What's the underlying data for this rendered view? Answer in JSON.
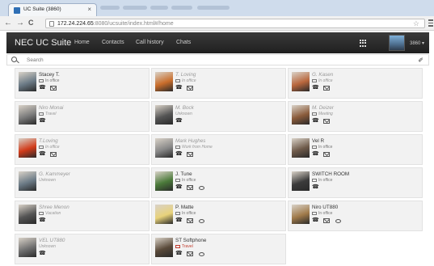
{
  "browser": {
    "tab_title": "UC Suite (3860)",
    "tab_close": "×",
    "nav_back": "←",
    "nav_forward": "→",
    "reload": "C",
    "url_host": "172.24.224.65",
    "url_path": ":8080/ucsuite/index.html#/home",
    "star": "☆"
  },
  "navbar": {
    "brand": "NEC UC Suite",
    "links": [
      "Home",
      "Contacts",
      "Call history",
      "Chats"
    ],
    "user_label": "3860 ▾"
  },
  "search": {
    "placeholder": "Search",
    "clear": "✐"
  },
  "contacts": [
    {
      "name": "Stacey T.",
      "status": "In office",
      "avatar": "#6b7a86"
    },
    {
      "name": "T. Loving",
      "status": "In office",
      "avatar": "#c96d2b"
    },
    {
      "name": "G. Kasen",
      "status": "In office",
      "avatar": "#b9673d"
    },
    {
      "name": "Niro Monai",
      "status": "Travel",
      "avatar": "#7b7b7b"
    },
    {
      "name": "M. Bock",
      "status": "Unknown",
      "avatar": "#555555"
    },
    {
      "name": "M. Deizer",
      "status": "Meeting",
      "avatar": "#8a5b3b"
    },
    {
      "name": "T.Loving",
      "status": "In office",
      "avatar": "#d13b1a"
    },
    {
      "name": "Mark Hughes",
      "status": "Work from Home",
      "avatar": "#888888"
    },
    {
      "name": "Vel R",
      "status": "In office",
      "avatar": "#6e5a4a"
    },
    {
      "name": "G. Kammeyer",
      "status": "Unknown",
      "avatar": "#6b7a86"
    },
    {
      "name": "J. Tune",
      "status": "In office",
      "avatar": "#4b7a3a"
    },
    {
      "name": "SWITCH ROOM",
      "status": "In office",
      "avatar": "#3b3b3b"
    },
    {
      "name": "Shree Menon",
      "status": "Vacation",
      "avatar": "#555555"
    },
    {
      "name": "P. Matte",
      "status": "In office",
      "avatar": "#e8d27a"
    },
    {
      "name": "Niro UT880",
      "status": "In office",
      "avatar": "#a07a4a"
    },
    {
      "name": "VEL UT880",
      "status": "Unknown",
      "avatar": "#707070"
    },
    {
      "name": "ST Softphone",
      "status": "Travel",
      "avatar": "#5a4a3a"
    }
  ]
}
